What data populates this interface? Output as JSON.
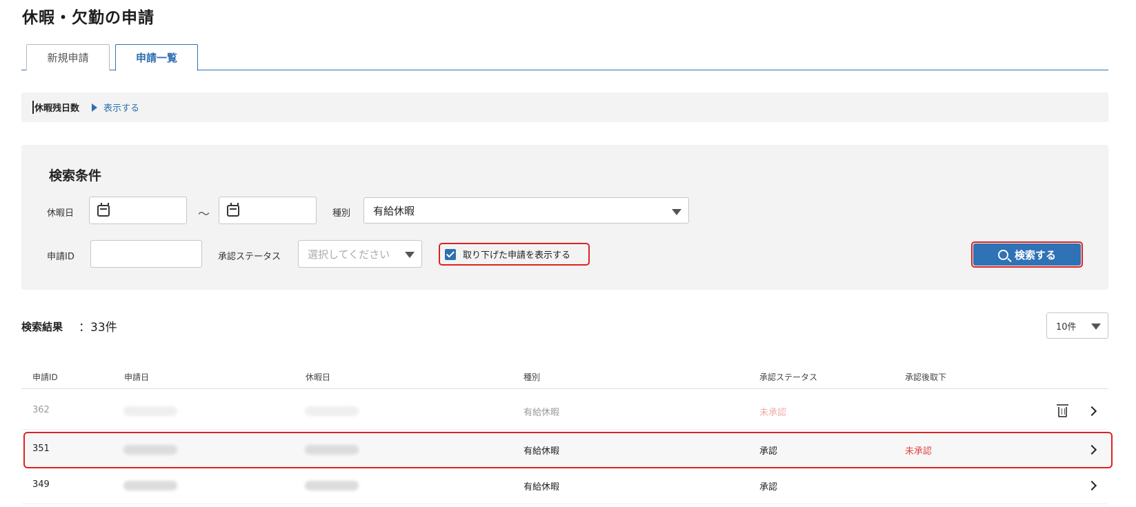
{
  "page_title": "休暇・欠勤の申請",
  "tabs": [
    {
      "label": "新規申請",
      "active": false
    },
    {
      "label": "申請一覧",
      "active": true
    }
  ],
  "leave_balance": {
    "label": "休暇残日数",
    "toggle_label": "表示する"
  },
  "search": {
    "title": "検索条件",
    "holiday_date_label": "休暇日",
    "date_from_value": "",
    "range_separator": "～",
    "date_to_value": "",
    "type_label": "種別",
    "type_value": "有給休暇",
    "request_id_label": "申請ID",
    "request_id_value": "",
    "approval_status_label": "承認ステータス",
    "approval_status_placeholder": "選択してください",
    "show_withdrawn_label": "取り下げた申請を表示する",
    "show_withdrawn_checked": true,
    "search_button_label": "検索する"
  },
  "results": {
    "label": "検索結果",
    "count_text": "：33件",
    "per_page_value": "10件",
    "columns": [
      "申請ID",
      "申請日",
      "休暇日",
      "種別",
      "承認ステータス",
      "承認後取下"
    ],
    "rows": [
      {
        "id": "362",
        "type": "有給休暇",
        "status": "未承認",
        "post_withdraw": "",
        "faded": true,
        "deletable": true
      },
      {
        "id": "351",
        "type": "有給休暇",
        "status": "承認",
        "post_withdraw": "未承認",
        "faded": false,
        "deletable": false,
        "highlighted": true
      },
      {
        "id": "349",
        "type": "有給休暇",
        "status": "承認",
        "post_withdraw": "",
        "faded": false,
        "deletable": false
      }
    ]
  },
  "colors": {
    "accent": "#2f6fb0",
    "highlight_border": "#e02020",
    "status_red": "#e04545"
  }
}
